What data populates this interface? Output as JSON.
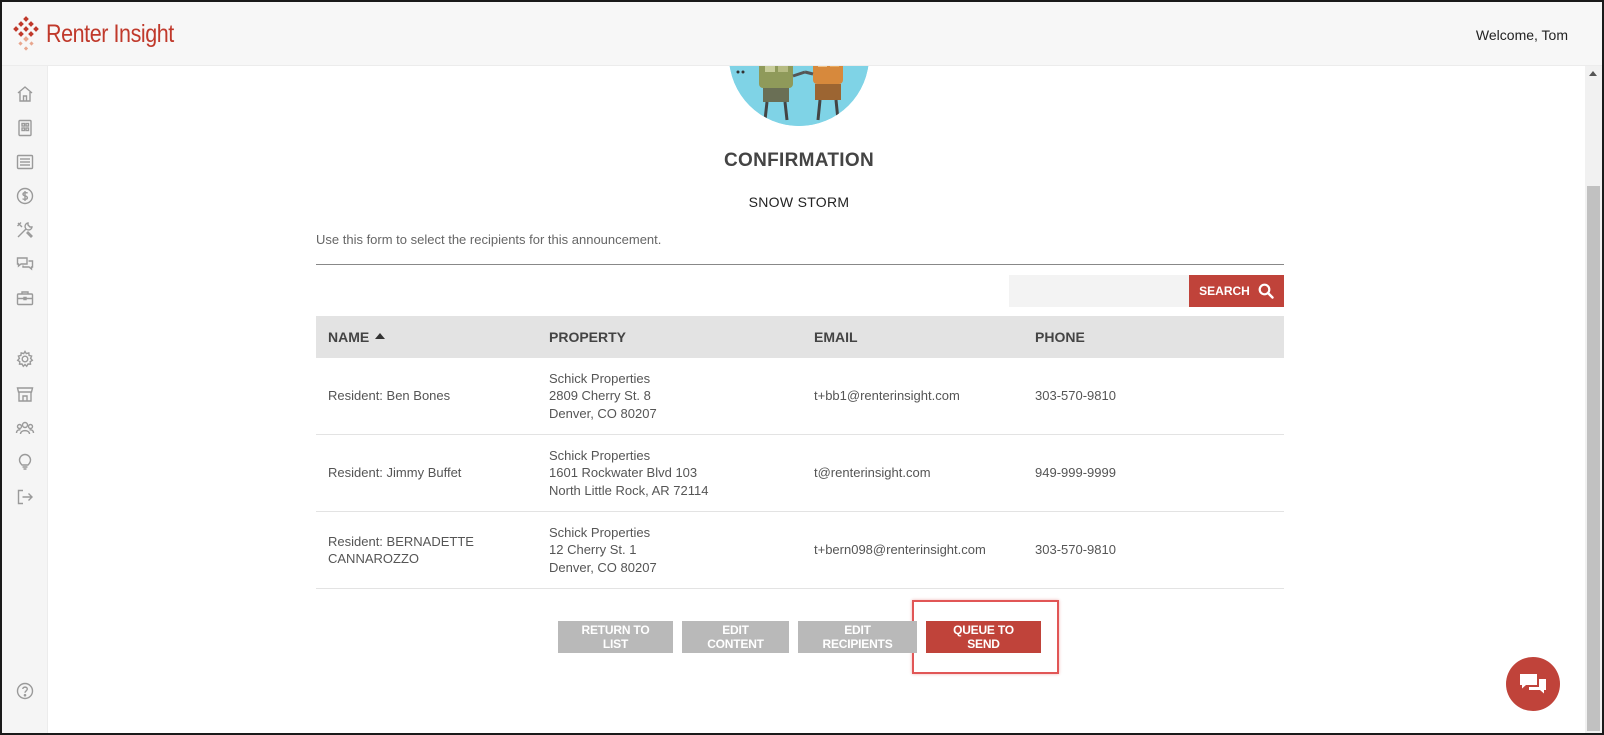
{
  "app": {
    "logo_text": "Renter Insight",
    "welcome": "Welcome, Tom"
  },
  "sidebar": {
    "items": [
      {
        "icon": "home-icon"
      },
      {
        "icon": "building-icon"
      },
      {
        "icon": "list-icon"
      },
      {
        "icon": "dollar-icon"
      },
      {
        "icon": "tools-icon"
      },
      {
        "icon": "chat-bubbles-icon"
      },
      {
        "icon": "briefcase-icon"
      },
      {
        "icon": "gear-icon"
      },
      {
        "icon": "store-icon"
      },
      {
        "icon": "users-icon"
      },
      {
        "icon": "lightbulb-icon"
      },
      {
        "icon": "logout-icon"
      },
      {
        "icon": "help-icon"
      }
    ]
  },
  "page": {
    "title": "CONFIRMATION",
    "subtitle": "SNOW STORM",
    "instructions": "Use this form to select the recipients for this announcement."
  },
  "search": {
    "value": "",
    "button_label": "SEARCH"
  },
  "table": {
    "headers": {
      "name": "NAME",
      "property": "PROPERTY",
      "email": "EMAIL",
      "phone": "PHONE"
    },
    "rows": [
      {
        "name": "Resident: Ben Bones",
        "property": [
          "Schick Properties",
          "2809 Cherry St. 8",
          "Denver, CO 80207"
        ],
        "email": "t+bb1@renterinsight.com",
        "phone": "303-570-9810"
      },
      {
        "name": "Resident: Jimmy Buffet",
        "property": [
          "Schick Properties",
          "1601 Rockwater Blvd 103",
          "North Little Rock, AR 72114"
        ],
        "email": "t@renterinsight.com",
        "phone": "949-999-9999"
      },
      {
        "name": "Resident: BERNADETTE CANNAROZZO",
        "property": [
          "Schick Properties",
          "12 Cherry St. 1",
          "Denver, CO 80207"
        ],
        "email": "t+bern098@renterinsight.com",
        "phone": "303-570-9810"
      }
    ]
  },
  "actions": {
    "return_label": "RETURN TO LIST",
    "edit_content_label": "EDIT CONTENT",
    "edit_recipients_label": "EDIT RECIPIENTS",
    "queue_label": "QUEUE TO SEND"
  },
  "colors": {
    "accent": "#c0433a",
    "muted_button": "#b9b9b9",
    "header_bg": "#e3e3e3"
  }
}
